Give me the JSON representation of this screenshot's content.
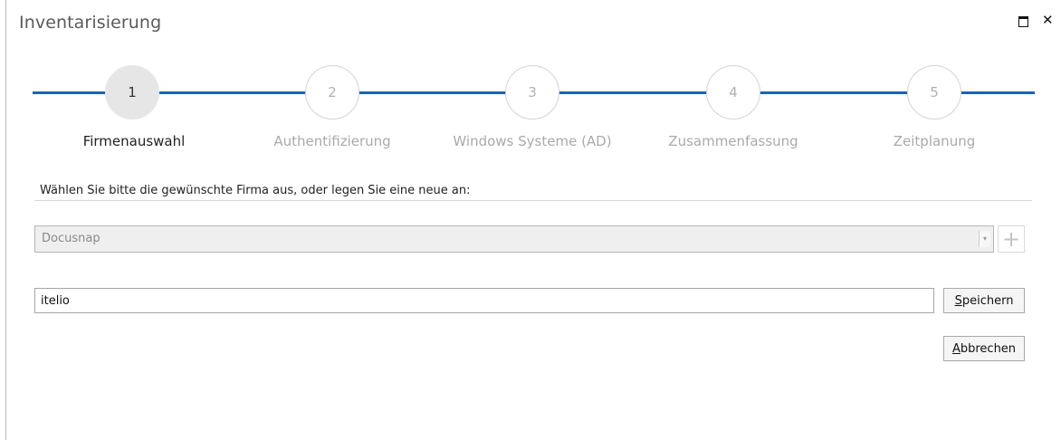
{
  "window": {
    "title": "Inventarisierung",
    "maximize_icon": "maximize-icon",
    "close_icon": "close-icon",
    "close_glyph": "✕"
  },
  "stepper": {
    "accent_color": "#1c63b7",
    "active_step": 1,
    "steps": [
      {
        "number": "1",
        "label": "Firmenauswahl"
      },
      {
        "number": "2",
        "label": "Authentifizierung"
      },
      {
        "number": "3",
        "label": "Windows Systeme (AD)"
      },
      {
        "number": "4",
        "label": "Zusammenfassung"
      },
      {
        "number": "5",
        "label": "Zeitplanung"
      }
    ]
  },
  "form": {
    "instruction": "Wählen Sie bitte die gewünschte Firma aus, oder legen Sie eine neue an:",
    "company_select": {
      "value": "Docusnap",
      "arrow_glyph": "▾"
    },
    "add_button": {
      "glyph": "+",
      "icon": "plus-icon"
    },
    "new_company": {
      "value": "itelio",
      "placeholder": ""
    },
    "save_button": {
      "mnemonic": "S",
      "rest": "peichern"
    },
    "cancel_button": {
      "mnemonic": "A",
      "rest": "bbrechen"
    }
  }
}
